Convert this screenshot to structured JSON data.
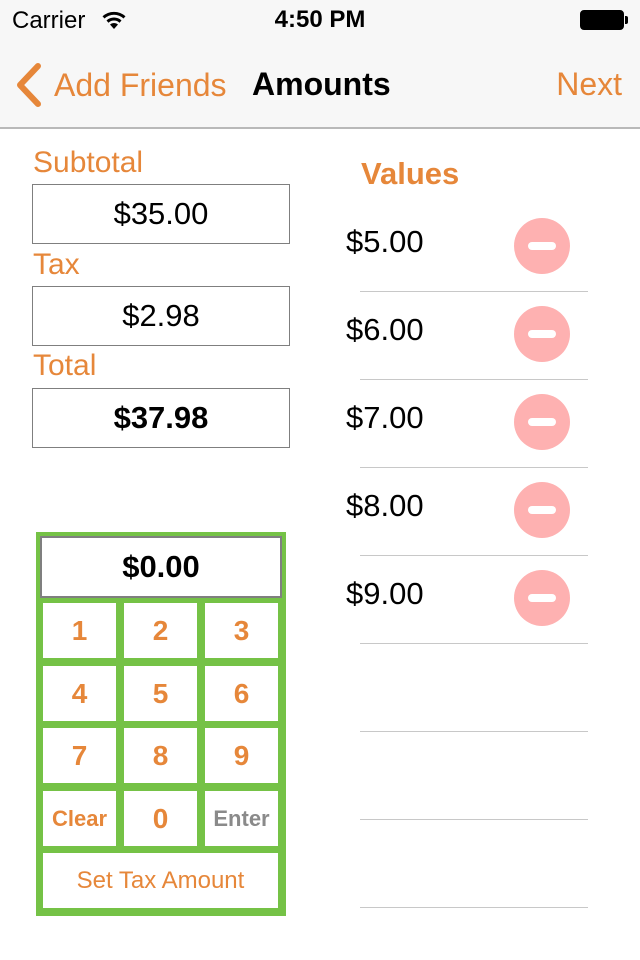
{
  "status_bar": {
    "carrier": "Carrier",
    "time": "4:50 PM",
    "wifi_icon": "wifi-icon",
    "battery_icon": "battery-full-icon"
  },
  "nav": {
    "back_label": "Add Friends",
    "back_icon": "chevron-left-icon",
    "title": "Amounts",
    "next_label": "Next"
  },
  "fields": {
    "subtotal_label": "Subtotal",
    "subtotal_value": "$35.00",
    "tax_label": "Tax",
    "tax_value": "$2.98",
    "total_label": "Total",
    "total_value": "$37.98"
  },
  "keypad": {
    "display": "$0.00",
    "keys": [
      "1",
      "2",
      "3",
      "4",
      "5",
      "6",
      "7",
      "8",
      "9",
      "Clear",
      "0",
      "Enter"
    ],
    "set_tax_label": "Set Tax Amount"
  },
  "values": {
    "title": "Values",
    "items": [
      "$5.00",
      "$6.00",
      "$7.00",
      "$8.00",
      "$9.00"
    ],
    "remove_icon": "minus-circle-icon"
  },
  "colors": {
    "accent": "#e6873a",
    "keypad_border": "#75c246",
    "remove_button": "#feb1b1",
    "enter_key": "#8a8a8a"
  }
}
